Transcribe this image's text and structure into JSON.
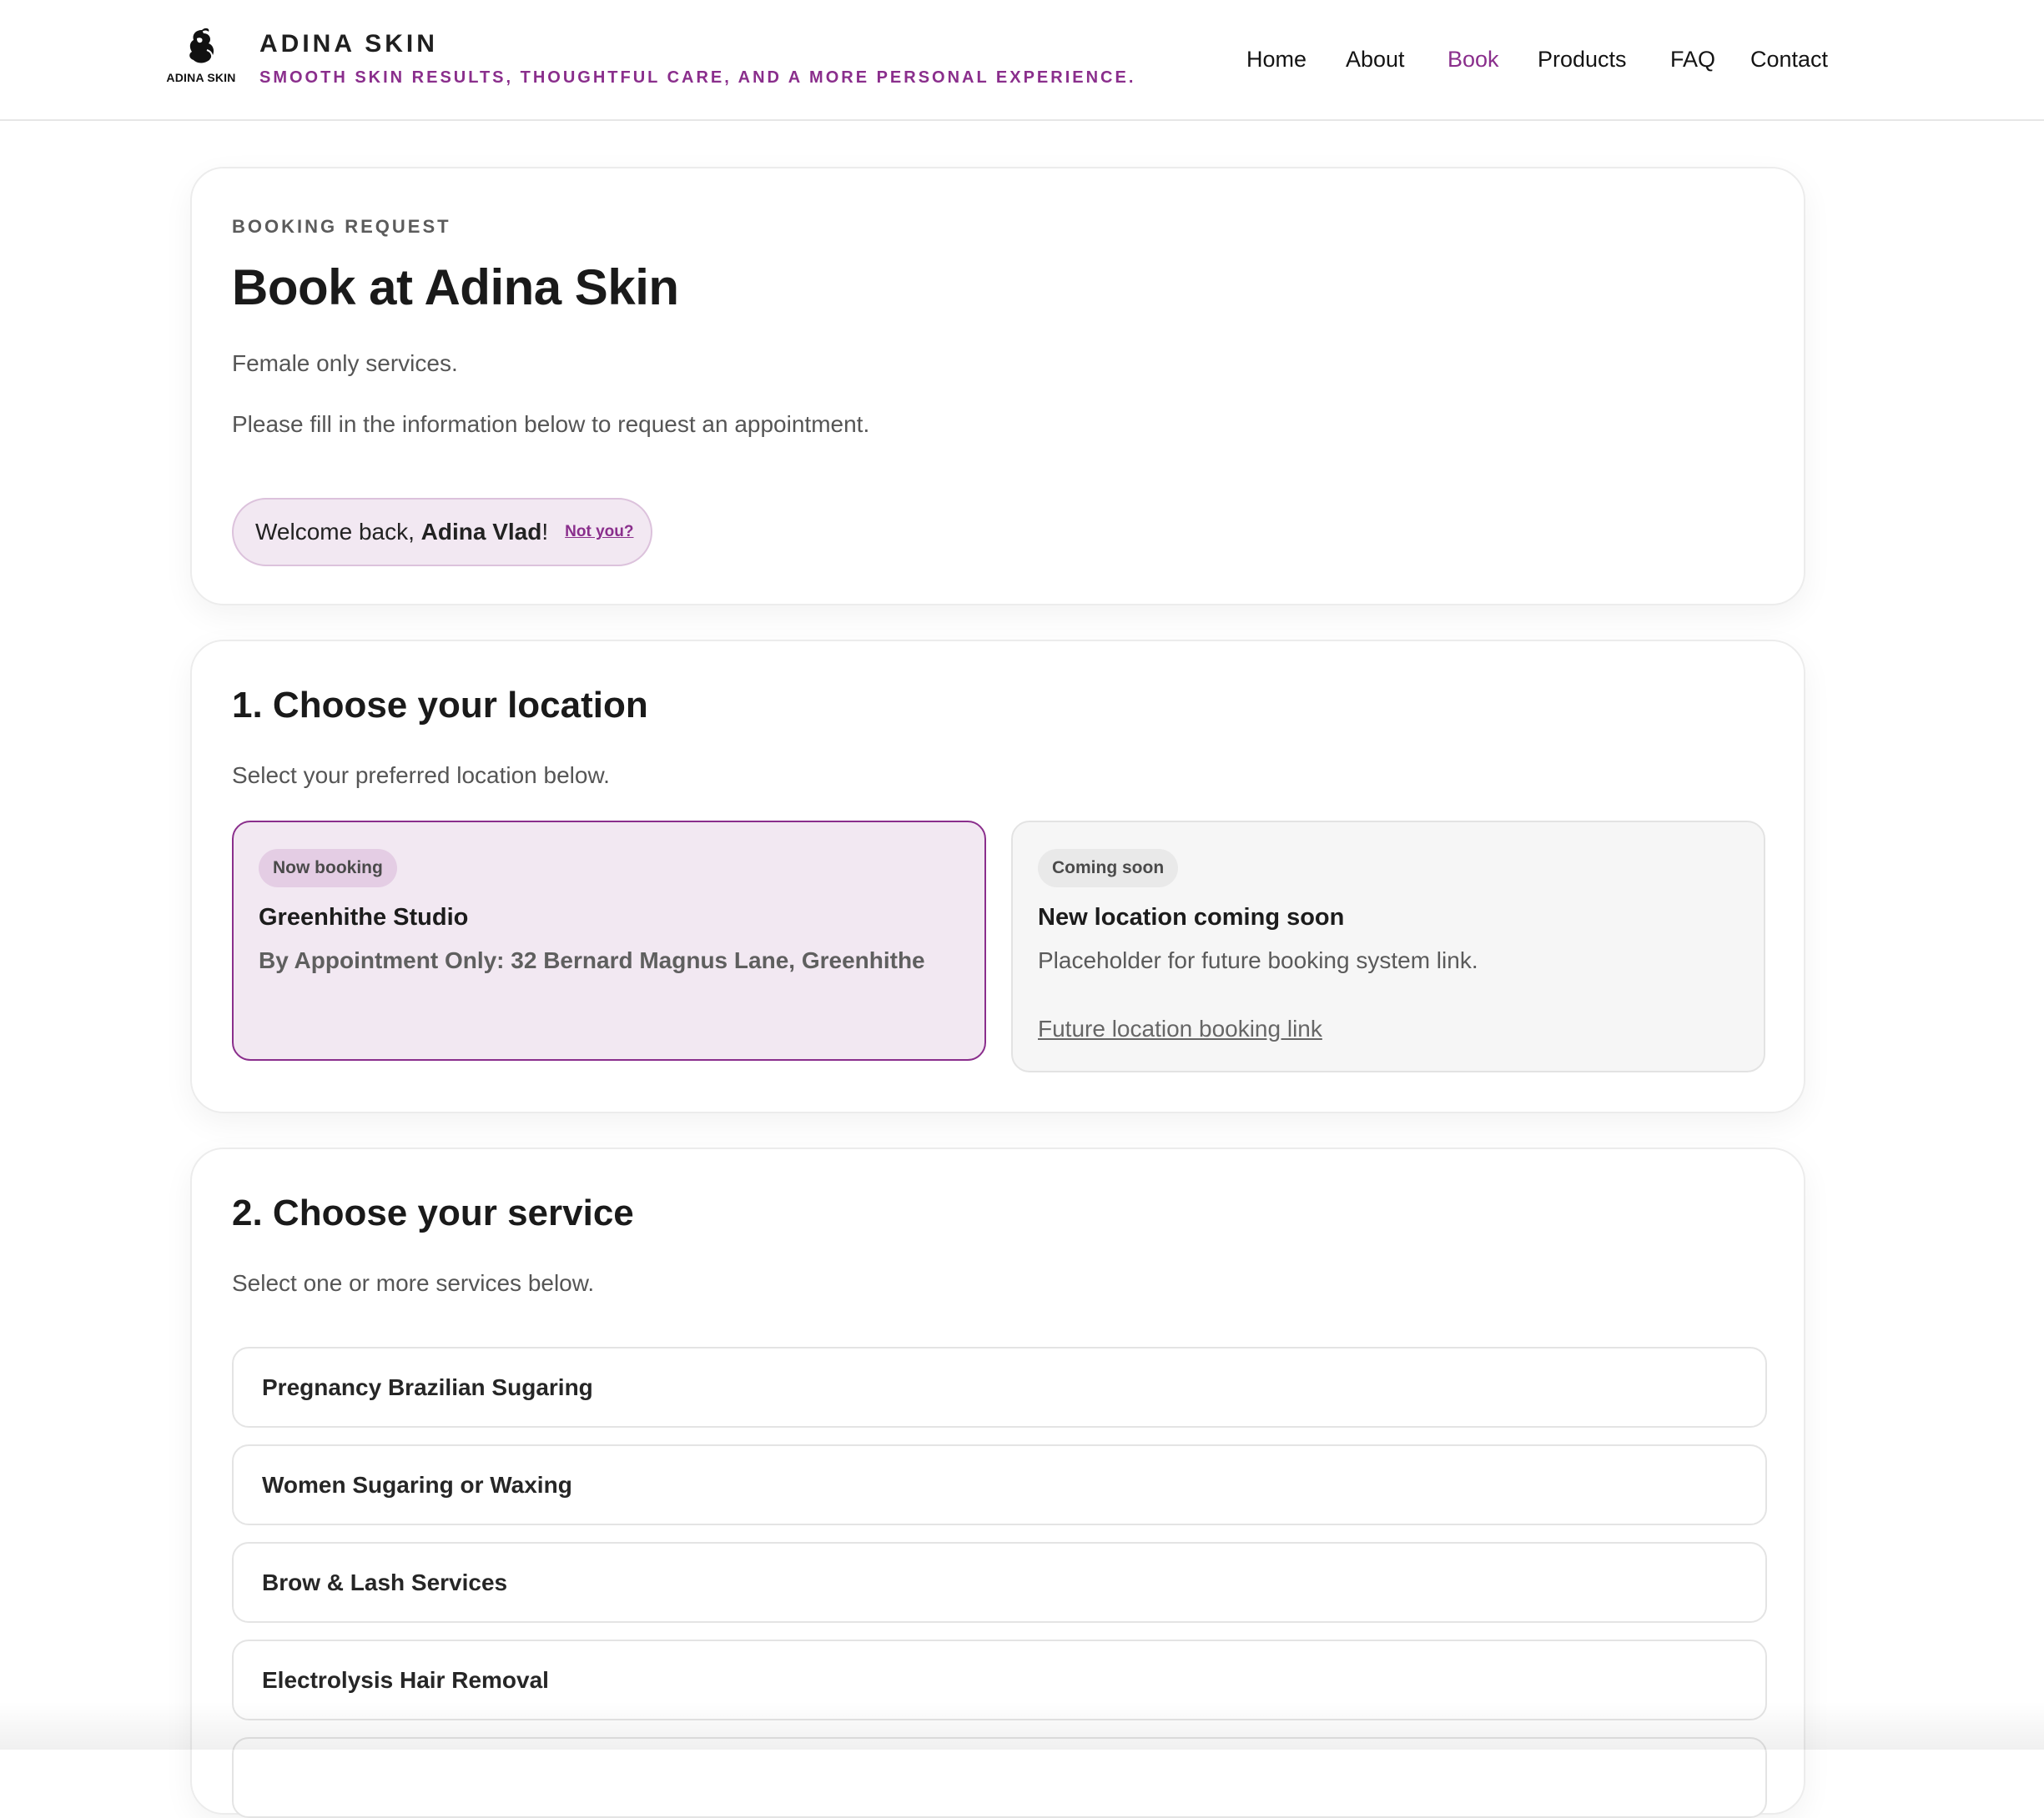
{
  "header": {
    "logo_text": "ADINA SKIN",
    "brand_name": "ADINA SKIN",
    "tagline": "SMOOTH SKIN RESULTS, THOUGHTFUL CARE, AND A MORE PERSONAL EXPERIENCE.",
    "nav": [
      {
        "label": "Home",
        "active": false
      },
      {
        "label": "About",
        "active": false
      },
      {
        "label": "Book",
        "active": true
      },
      {
        "label": "Products",
        "active": false
      },
      {
        "label": "FAQ",
        "active": false
      },
      {
        "label": "Contact",
        "active": false
      }
    ]
  },
  "intro": {
    "eyebrow": "BOOKING REQUEST",
    "title": "Book at Adina Skin",
    "line1": "Female only services.",
    "line2": "Please fill in the information below to request an appointment.",
    "welcome_prefix": "Welcome back, ",
    "user_name": "Adina Vlad",
    "welcome_suffix": "!",
    "not_you": "Not you?"
  },
  "location": {
    "title": "1. Choose your location",
    "subtitle": "Select your preferred location below.",
    "options": [
      {
        "badge": "Now booking",
        "name": "Greenhithe Studio",
        "description": "By Appointment Only: 32 Bernard Magnus Lane, Greenhithe",
        "selected": true
      },
      {
        "badge": "Coming soon",
        "name": "New location coming soon",
        "description": "Placeholder for future booking system link.",
        "link": "Future location booking link",
        "selected": false
      }
    ]
  },
  "service": {
    "title": "2. Choose your service",
    "subtitle": "Select one or more services below.",
    "items": [
      "Pregnancy Brazilian Sugaring",
      "Women Sugaring or Waxing",
      "Brow & Lash Services",
      "Electrolysis Hair Removal"
    ]
  },
  "colors": {
    "accent": "#8a2e8c",
    "selected_bg": "#f2e8f2",
    "text": "#1c1c1c",
    "muted": "#555555"
  }
}
